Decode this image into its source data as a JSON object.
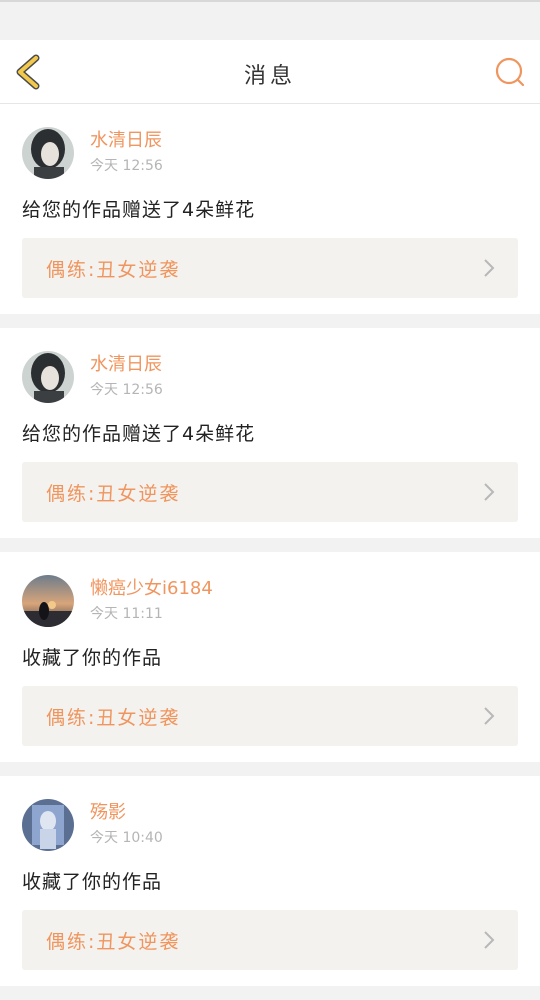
{
  "header": {
    "title": "消息"
  },
  "messages": [
    {
      "user": "水清日辰",
      "time": "今天 12:56",
      "text": "给您的作品赠送了4朵鲜花",
      "work": "偶练:丑女逆袭"
    },
    {
      "user": "水清日辰",
      "time": "今天 12:56",
      "text": "给您的作品赠送了4朵鲜花",
      "work": "偶练:丑女逆袭"
    },
    {
      "user": "懒癌少女i6184",
      "time": "今天 11:11",
      "text": "收藏了你的作品",
      "work": "偶练:丑女逆袭"
    },
    {
      "user": "殇影",
      "time": "今天 10:40",
      "text": "收藏了你的作品",
      "work": "偶练:丑女逆袭"
    }
  ],
  "colors": {
    "accent": "#f0955e",
    "back_arrow": "#f2c94c"
  },
  "icons": {
    "back": "chevron-left-icon",
    "search": "search-icon",
    "link": "chevron-right-icon"
  }
}
